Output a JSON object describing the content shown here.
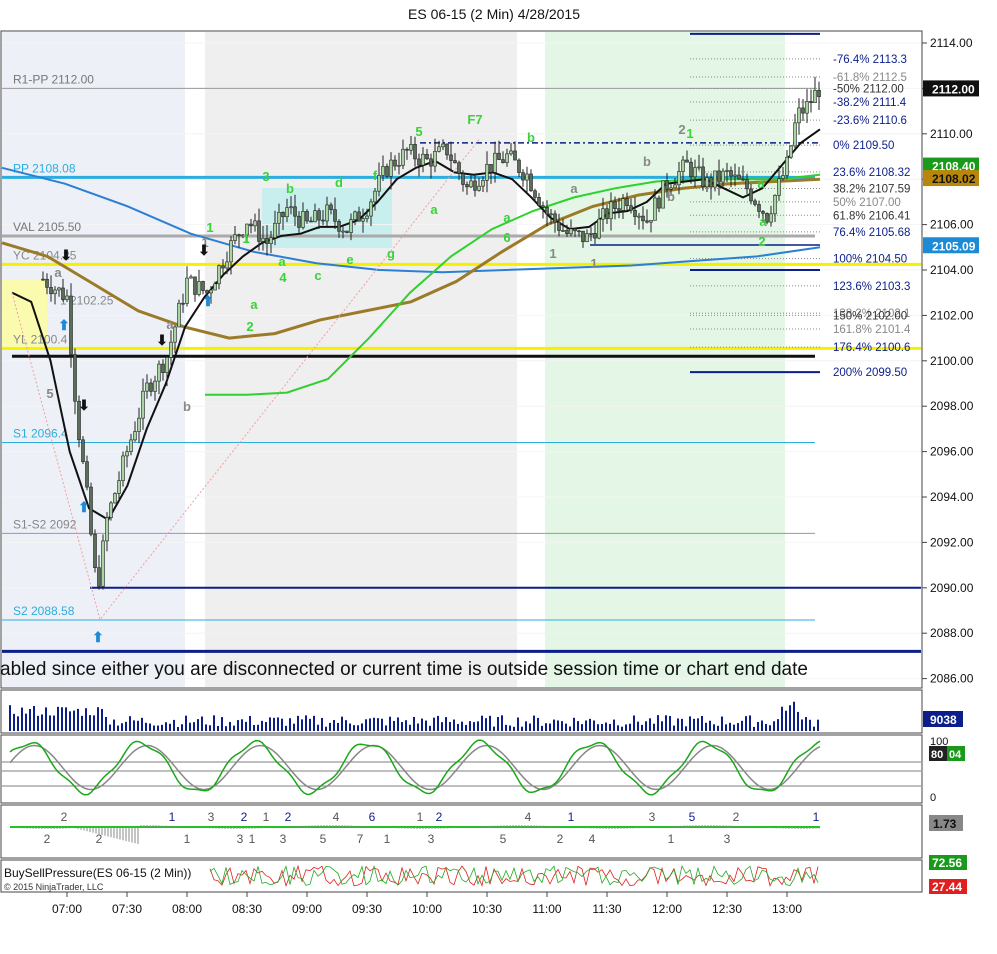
{
  "title": "ES 06-15 (2 Min)  4/28/2015",
  "colors": {
    "background": "#ffffff",
    "session_shade": "#eef0f8",
    "gray_shade": "#efefef",
    "green_shade": "#e4f7e6",
    "up_candle": "#a6d5a0",
    "down_candle": "#5a6e5a",
    "pivot_blue": "#2aaee0",
    "yellow_line": "#f5f000",
    "navy": "#0b1e8a",
    "green_label": "#39d239",
    "price_tag": "#101010",
    "green_tag": "#1a9a1a",
    "blue_tag": "#1d8ad6",
    "red_tag": "#e02020"
  },
  "price_axis": {
    "ticks": [
      "2114.00",
      "2112.00",
      "2110.00",
      "2108.00",
      "2106.00",
      "2104.00",
      "2102.00",
      "2100.00",
      "2098.00",
      "2096.00",
      "2094.00",
      "2092.00",
      "2090.00",
      "2088.00",
      "2086.00"
    ],
    "current_price": "2112.00",
    "tag_green_top": "2108.40",
    "tag_brown": "2108.02",
    "tag_blue": "2105.09"
  },
  "time_axis": {
    "ticks": [
      "07:00",
      "07:30",
      "08:00",
      "08:30",
      "09:00",
      "09:30",
      "10:00",
      "10:30",
      "11:00",
      "11:30",
      "12:00",
      "12:30",
      "13:00"
    ]
  },
  "levels": {
    "r1_pp": "R1-PP 2112.00",
    "pp": "PP 2108.08",
    "val": "VAL 2105.50",
    "yc": "YC 2104.25",
    "s1": "S1 2096.4",
    "s1_s2": "S1-S2 2092",
    "s2": "S2 2088.58",
    "partial_1": "1 2102.25",
    "partial_yl": "YL 2100.4"
  },
  "fib_labels": [
    "-76.4%  2113.3",
    "-61.8%  2112.5",
    "-50%  2112.00",
    "-38.2%  2111.4",
    "-23.6%  2110.6",
    "0%  2109.50",
    "23.6%  2108.32",
    "38.2%  2107.59",
    "50%  2107.00",
    "61.8%  2106.41",
    "76.4%  2105.68",
    "100%  2104.50",
    "123.6%  2103.3",
    "138.2%  2102.1",
    "150%  2102.00",
    "161.8%  2101.4",
    "176.4%  2100.6",
    "200%  2099.50"
  ],
  "wave_labels": {
    "green": [
      "1",
      "3",
      "b",
      "d",
      "f",
      "5",
      "F7",
      "b",
      "1",
      "a",
      "a",
      "a",
      "2",
      "4",
      "c",
      "e",
      "g",
      "a",
      "a",
      "6",
      "1",
      "a",
      "2"
    ],
    "gray": [
      "a",
      "5",
      "a",
      "b",
      "1",
      "1",
      "a",
      "b",
      "2",
      "b",
      "1"
    ]
  },
  "marquee": "abled since either you are disconnected or current time is outside session time or chart end date",
  "volume_panel": {
    "value": "9038"
  },
  "stochastic_panel": {
    "top": "100",
    "bottom": "0",
    "tag_dark": "80",
    "tag_green": "04"
  },
  "momentum_panel": {
    "value": "1.73",
    "above": [
      "2",
      "1",
      "3",
      "2",
      "1",
      "2",
      "4",
      "6",
      "1",
      "2",
      "4",
      "1",
      "3",
      "5",
      "2",
      "1"
    ],
    "below": [
      "2",
      "2",
      "1",
      "3",
      "1",
      "3",
      "5",
      "7",
      "1",
      "3",
      "5",
      "2",
      "4",
      "1",
      "3"
    ]
  },
  "pressure_panel": {
    "label": "BuySellPressure(ES 06-15 (2 Min))",
    "copyright": "© 2015 NinjaTrader, LLC",
    "buy": "72.56",
    "sell": "27.44"
  },
  "chart_data": {
    "type": "candlestick",
    "title": "ES 06-15 (2 Min)  4/28/2015",
    "x_range": [
      "06:48",
      "13:18"
    ],
    "y_range": [
      2085.6,
      2114.6
    ],
    "close_series": {
      "x": [
        "06:48",
        "07:00",
        "07:05",
        "07:10",
        "07:15",
        "07:20",
        "07:30",
        "07:40",
        "07:50",
        "08:00",
        "08:10",
        "08:20",
        "08:30",
        "08:40",
        "08:50",
        "09:00",
        "09:10",
        "09:20",
        "09:30",
        "09:40",
        "09:50",
        "10:00",
        "10:10",
        "10:20",
        "10:30",
        "10:40",
        "10:50",
        "11:00",
        "11:10",
        "11:20",
        "11:30",
        "11:40",
        "11:50",
        "12:00",
        "12:10",
        "12:20",
        "12:30",
        "12:40",
        "12:50",
        "13:00",
        "13:05",
        "13:10",
        "13:16"
      ],
      "y": [
        2103.6,
        2102.8,
        2097.5,
        2094.0,
        2089.8,
        2093.0,
        2096.0,
        2098.8,
        2100.2,
        2103.5,
        2103.0,
        2104.8,
        2106.2,
        2105.2,
        2106.7,
        2106.0,
        2106.5,
        2105.8,
        2106.8,
        2108.5,
        2109.2,
        2108.8,
        2109.3,
        2107.6,
        2108.5,
        2109.0,
        2108.2,
        2106.5,
        2105.6,
        2105.4,
        2106.5,
        2107.2,
        2106.2,
        2107.8,
        2108.6,
        2107.8,
        2108.2,
        2107.6,
        2106.4,
        2108.6,
        2110.8,
        2111.2,
        2112.0
      ]
    },
    "sma_black": [
      2103.0,
      2102.6,
      2100.0,
      2096.0,
      2093.5,
      2093.0,
      2094.5,
      2097.0,
      2099.0,
      2101.5,
      2102.8,
      2103.8,
      2104.6,
      2105.2,
      2105.5,
      2105.6,
      2105.9,
      2105.9,
      2106.2,
      2107.0,
      2108.0,
      2108.5,
      2108.8,
      2108.3,
      2108.2,
      2108.3,
      2108.0,
      2107.2,
      2106.3,
      2105.8,
      2105.9,
      2106.5,
      2106.6,
      2107.0,
      2107.8,
      2107.9,
      2108.0,
      2107.6,
      2107.2,
      2107.6,
      2108.6,
      2109.6,
      2110.2
    ],
    "green_ma": [
      2098.5,
      2098.5,
      2098.6,
      2099.2,
      2101.0,
      2103.0,
      2104.6,
      2105.8,
      2106.6,
      2107.2,
      2107.6,
      2107.9,
      2108.0,
      2108.0,
      2108.0,
      2108.2
    ],
    "brown_ma": [
      2105.2,
      2104.6,
      2103.4,
      2102.2,
      2101.5,
      2101.0,
      2101.2,
      2101.8,
      2102.2,
      2102.6,
      2103.5,
      2104.8,
      2106.0,
      2106.8,
      2107.3,
      2107.6,
      2107.8,
      2107.9,
      2108.0
    ],
    "blue_ma": [
      2108.5,
      2107.8,
      2106.8,
      2105.6,
      2104.8,
      2104.3,
      2104.0,
      2103.9,
      2104.0,
      2104.1,
      2104.2,
      2104.4,
      2104.6,
      2105.0
    ],
    "horizontal_levels": [
      2112.0,
      2108.08,
      2105.5,
      2104.25,
      2100.4,
      2100.2,
      2096.4,
      2092.4,
      2090.0,
      2088.58,
      2087.2
    ]
  }
}
